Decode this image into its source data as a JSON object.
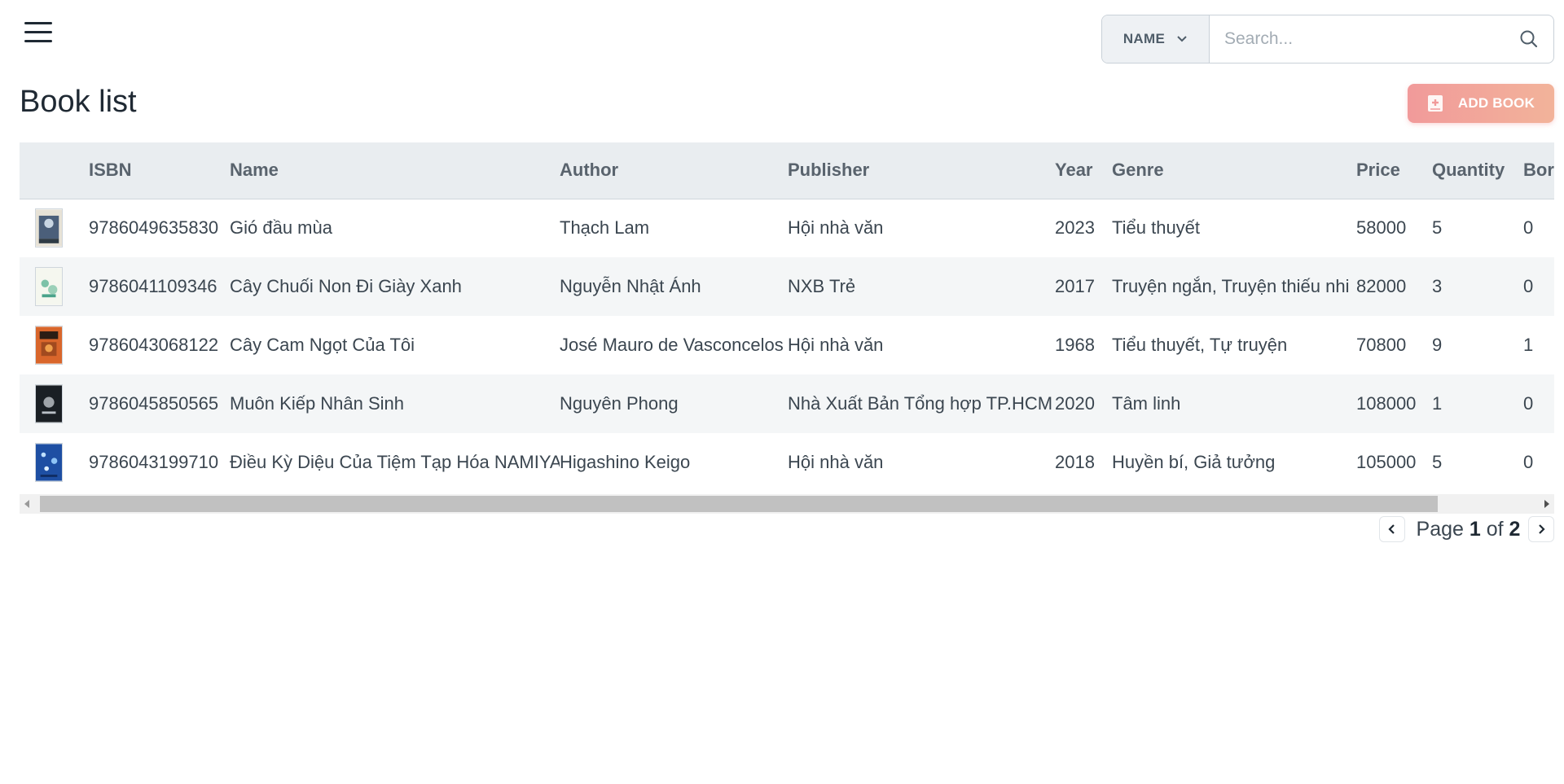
{
  "search": {
    "filter_label": "NAME",
    "placeholder": "Search..."
  },
  "page_title": "Book list",
  "add_book_label": "ADD BOOK",
  "table": {
    "columns": [
      "",
      "ISBN",
      "Name",
      "Author",
      "Publisher",
      "Year",
      "Genre",
      "Price",
      "Quantity",
      "Borr"
    ],
    "rows": [
      {
        "isbn": "9786049635830",
        "name": "Gió đầu mùa",
        "author": "Thạch Lam",
        "publisher": "Hội nhà văn",
        "year": "2023",
        "genre": "Tiểu thuyết",
        "price": "58000",
        "quantity": "5",
        "borrowed": "0"
      },
      {
        "isbn": "9786041109346",
        "name": "Cây Chuối Non Đi Giày Xanh",
        "author": "Nguyễn Nhật Ánh",
        "publisher": "NXB Trẻ",
        "year": "2017",
        "genre": "Truyện ngắn, Truyện thiếu nhi",
        "price": "82000",
        "quantity": "3",
        "borrowed": "0"
      },
      {
        "isbn": "9786043068122",
        "name": "Cây Cam Ngọt Của Tôi",
        "author": "José Mauro de Vasconcelos",
        "publisher": "Hội nhà văn",
        "year": "1968",
        "genre": "Tiểu thuyết, Tự truyện",
        "price": "70800",
        "quantity": "9",
        "borrowed": "1"
      },
      {
        "isbn": "9786045850565",
        "name": "Muôn Kiếp Nhân Sinh",
        "author": "Nguyên Phong",
        "publisher": "Nhà Xuất Bản Tổng hợp TP.HCM",
        "year": "2020",
        "genre": "Tâm linh",
        "price": "108000",
        "quantity": "1",
        "borrowed": "0"
      },
      {
        "isbn": "9786043199710",
        "name": "Điều Kỳ Diệu Của Tiệm Tạp Hóa NAMIYA",
        "author": "Higashino Keigo",
        "publisher": "Hội nhà văn",
        "year": "2018",
        "genre": "Huyền bí, Giả tưởng",
        "price": "105000",
        "quantity": "5",
        "borrowed": "0"
      }
    ]
  },
  "pagination": {
    "page_word": "Page",
    "current": "1",
    "of_word": "of",
    "total": "2"
  }
}
